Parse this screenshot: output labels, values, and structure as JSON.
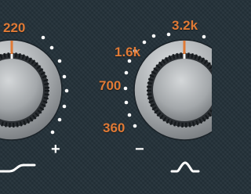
{
  "eq": {
    "left_band": {
      "visible_freq_label": "220",
      "minus_label": "",
      "plus_label": "+",
      "filter_shape_icon": "low-shelf-icon",
      "indicator_color": "#e07a36"
    },
    "right_band": {
      "freq_labels": [
        "360",
        "700",
        "1.6k",
        "3.2k"
      ],
      "minus_label": "−",
      "filter_shape_icon": "bell-peak-icon",
      "indicator_color": "#e07a36"
    }
  },
  "colors": {
    "background": "#233038",
    "label_orange": "#e07a36",
    "dots": "#ffffff",
    "knob_metal": "#b8bcbf"
  }
}
